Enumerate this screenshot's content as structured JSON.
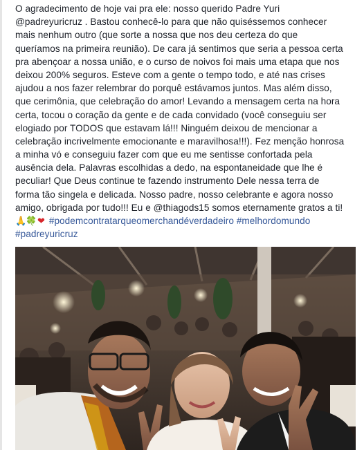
{
  "post": {
    "lines": [
      "O agradecimento de hoje vai pra ele: nosso querido Padre Yuri",
      "@padreyuricruz . Bastou conhecê-lo para que não quiséssemos conhecer",
      "mais nenhum outro (que sorte a nossa que nos deu certeza do que",
      "queríamos na primeira reunião). De cara já sentimos que seria a pessoa certa",
      "pra abençoar a nossa união, e o curso de noivos foi mais uma etapa que nos",
      "deixou 200% seguros. Esteve com a gente o tempo todo, e até nas crises",
      "ajudou a nos fazer relembrar do porquê estávamos juntos. Mas além disso,",
      "que cerimônia, que celebração do amor! Levando a mensagem certa na hora",
      "certa, tocou o coração da gente e de cada convidado (você conseguiu ser",
      "elogiado por TODOS que estavam lá!!! Ninguém deixou de mencionar a",
      "celebração incrivelmente emocionante e maravilhosa!!!). Fez menção honrosa",
      "a minha vó e conseguiu fazer com que eu me sentisse confortada pela",
      "ausência dela. Palavras escolhidas a dedo, na espontaneidade que lhe é",
      "peculiar! Que Deus continue te fazendo instrumento Dele nessa terra de",
      "forma tão singela e delicada. Nosso padre, nosso celebrante e agora nosso",
      "amigo, obrigada por tudo!!! Eu e @thiagods15 somos eternamente gratos a ti!"
    ],
    "emojis": {
      "pray": "🙏",
      "clover": "🍀",
      "heart": "❤"
    },
    "hashtags": [
      "#podemcontratarqueomerchandéverdadeiro",
      "#melhordomundo",
      "#padreyuricruz"
    ]
  },
  "photo": {
    "icon": "wedding-selfie-photo"
  },
  "colors": {
    "text": "#1d2129",
    "link": "#365899",
    "background": "#ffffff"
  }
}
